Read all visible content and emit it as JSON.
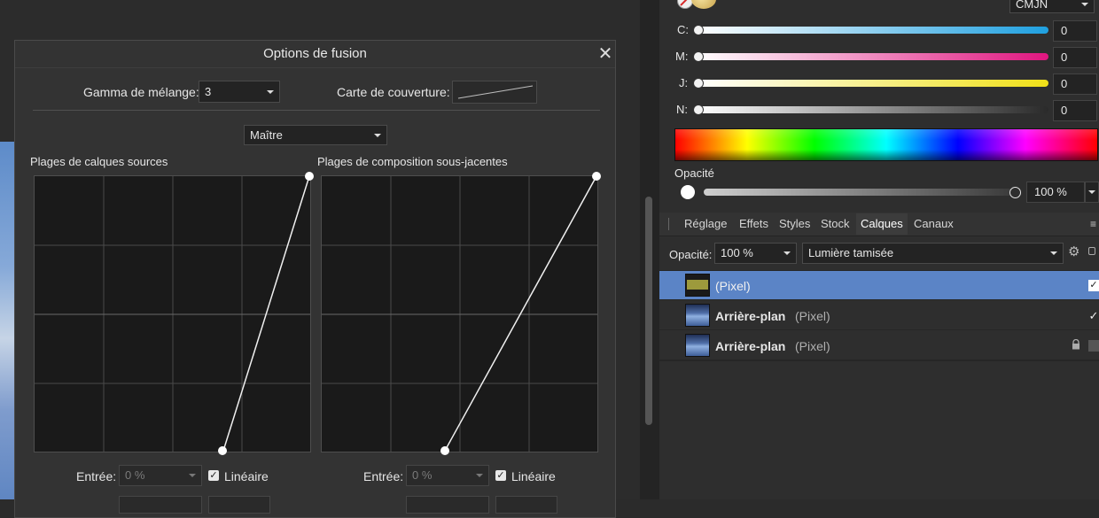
{
  "dialog": {
    "title": "Options de fusion",
    "gamma_label": "Gamma de mélange:",
    "gamma_value": "3",
    "coverage_label": "Carte de couverture:",
    "channel_value": "Maître",
    "source_title": "Plages de calques sources",
    "underlying_title": "Plages de composition sous-jacentes",
    "input_label": "Entrée:",
    "input_value": "0 %",
    "linear_label": "Linéaire"
  },
  "color": {
    "mode": "CMJN",
    "channels": [
      {
        "label": "C:",
        "value": "0",
        "color": "#1fa0e0"
      },
      {
        "label": "M:",
        "value": "0",
        "color": "#e0157f"
      },
      {
        "label": "J:",
        "value": "0",
        "color": "#f0e018"
      },
      {
        "label": "N:",
        "value": "0",
        "color": "#2a2a2a"
      }
    ],
    "opacity_label": "Opacité",
    "opacity_value": "100 %"
  },
  "tabs": [
    "Réglage",
    "Effets",
    "Styles",
    "Stock",
    "Calques",
    "Canaux"
  ],
  "active_tab": "Calques",
  "layers_panel": {
    "opacity_label": "Opacité:",
    "opacity_value": "100 %",
    "blend_mode": "Lumière tamisée",
    "layers": [
      {
        "name": "",
        "type": "(Pixel)",
        "selected": true,
        "thumb_color": "#9d9a3c"
      },
      {
        "name": "Arrière-plan",
        "type": "(Pixel)",
        "selected": false,
        "thumb_color": "#4f6fa8"
      },
      {
        "name": "Arrière-plan",
        "type": "(Pixel)",
        "selected": false,
        "thumb_color": "#4f6fa8"
      }
    ]
  },
  "accent": "#5b84c6"
}
